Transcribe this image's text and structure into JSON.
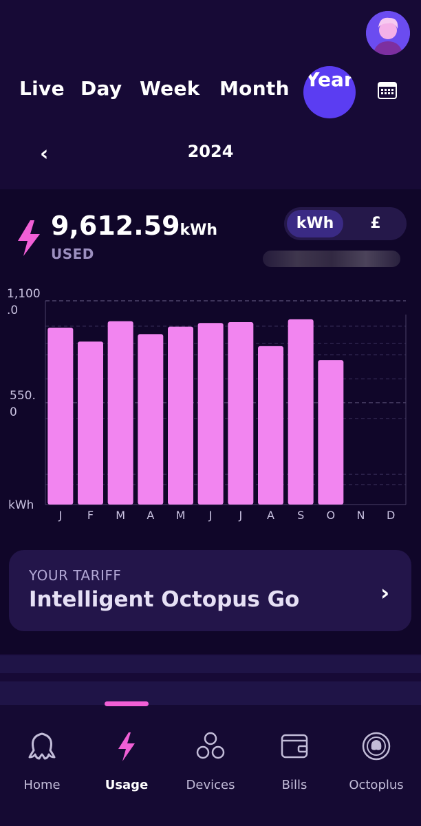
{
  "tabs": {
    "live": "Live",
    "day": "Day",
    "week": "Week",
    "month": "Month",
    "year": "Year",
    "calendar_icon": "calendar-icon"
  },
  "period": {
    "label": "2024",
    "prev_icon": "chevron-left-icon"
  },
  "summary": {
    "value": "9,612.59",
    "unit": "kWh",
    "caption": "USED"
  },
  "unit_toggle": {
    "options": [
      "kWh",
      "£"
    ],
    "selected": "kWh"
  },
  "chart_data": {
    "type": "bar",
    "categories": [
      "J",
      "F",
      "M",
      "A",
      "M",
      "J",
      "J",
      "A",
      "S",
      "O",
      "N",
      "D"
    ],
    "values": [
      955,
      880,
      990,
      920,
      960,
      980,
      985,
      855,
      1000,
      780,
      0,
      0
    ],
    "y_tick_labels": [
      "1,100\n.0",
      "550.\n0",
      "kWh"
    ],
    "ylim": [
      0,
      1100
    ],
    "bar_color": "#f285f0",
    "grid": true
  },
  "tariff": {
    "label": "YOUR TARIFF",
    "name": "Intelligent Octopus Go"
  },
  "nav": {
    "items": [
      {
        "label": "Home",
        "icon": "octopus-icon",
        "active": false
      },
      {
        "label": "Usage",
        "icon": "lightning-icon",
        "active": true
      },
      {
        "label": "Devices",
        "icon": "devices-icon",
        "active": false
      },
      {
        "label": "Bills",
        "icon": "wallet-icon",
        "active": false
      },
      {
        "label": "Octoplus",
        "icon": "octoplus-icon",
        "active": false
      }
    ]
  },
  "colors": {
    "background": "#170a36",
    "accent": "#f15fd6",
    "active_tab": "#5b3df2",
    "bar": "#f285f0"
  }
}
